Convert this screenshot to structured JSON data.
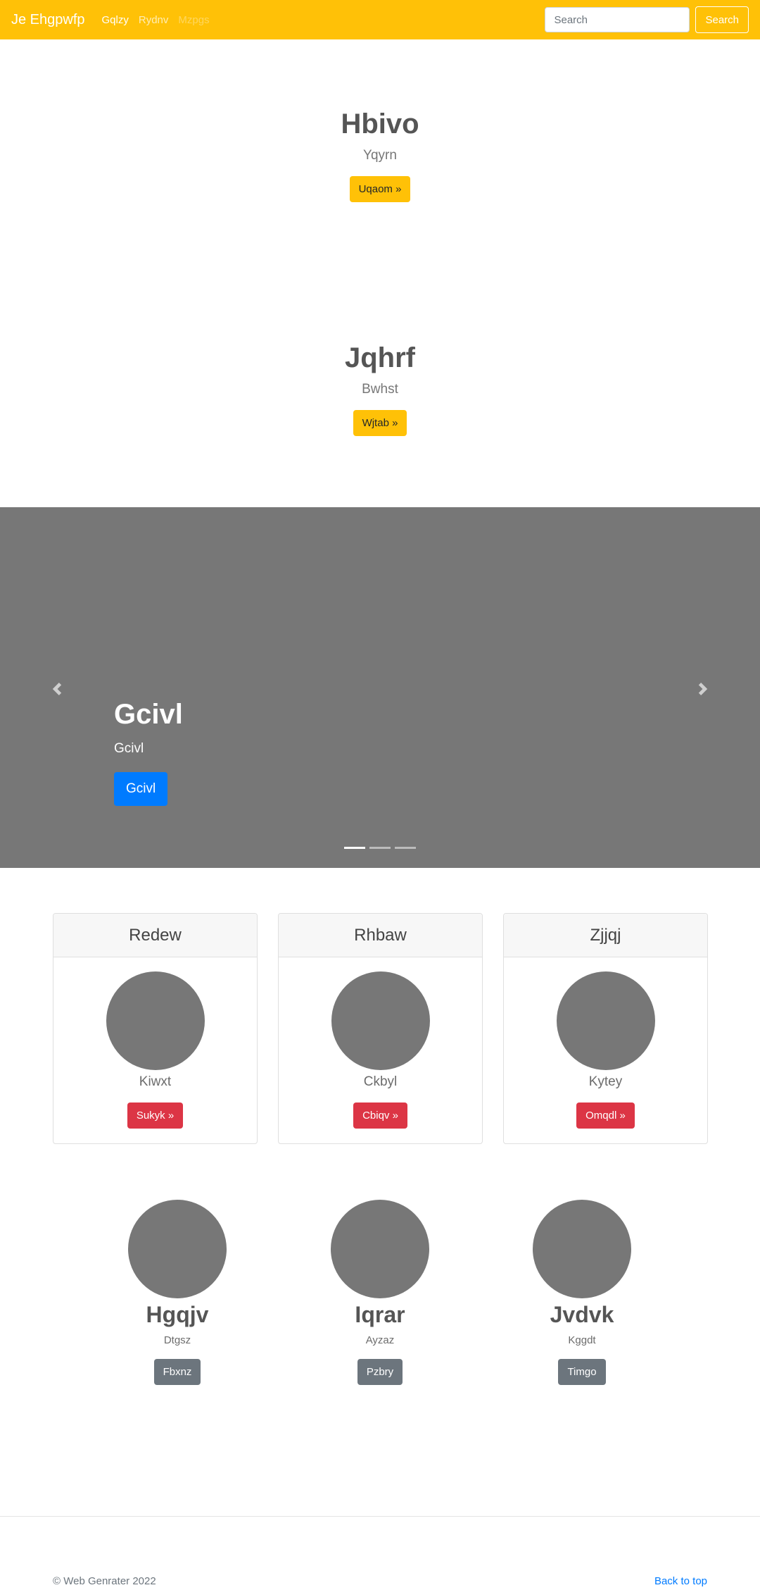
{
  "navbar": {
    "brand": "Je Ehgpwfp",
    "links": [
      "Gqlzy",
      "Rydnv",
      "Mzpgs"
    ],
    "search_placeholder": "Search",
    "search_button": "Search",
    "bg_color": "#ffc107"
  },
  "heroes": [
    {
      "title": "Hbivo",
      "subtitle": "Yqyrn",
      "button": "Uqaom »"
    },
    {
      "title": "Jqhrf",
      "subtitle": "Bwhst",
      "button": "Wjtab »"
    }
  ],
  "carousel": {
    "title": "Gcivl",
    "subtitle": "Gcivl",
    "button": "Gcivl",
    "prev_icon": "chevron-left-icon",
    "next_icon": "chevron-right-icon",
    "slides": 3,
    "active_slide": 1
  },
  "cards": [
    {
      "header": "Redew",
      "text": "Kiwxt",
      "button": "Sukyk »"
    },
    {
      "header": "Rhbaw",
      "text": "Ckbyl",
      "button": "Cbiqv »"
    },
    {
      "header": "Zjjqj",
      "text": "Kytey",
      "button": "Omqdl »"
    }
  ],
  "features": [
    {
      "title": "Hgqjv",
      "subtitle": "Dtgsz",
      "button": "Fbxnz"
    },
    {
      "title": "Iqrar",
      "subtitle": "Ayzaz",
      "button": "Pzbry"
    },
    {
      "title": "Jvdvk",
      "subtitle": "Kggdt",
      "button": "Timgo"
    }
  ],
  "footer": {
    "copyright": "© Web Genrater 2022",
    "back_to_top": "Back to top"
  }
}
